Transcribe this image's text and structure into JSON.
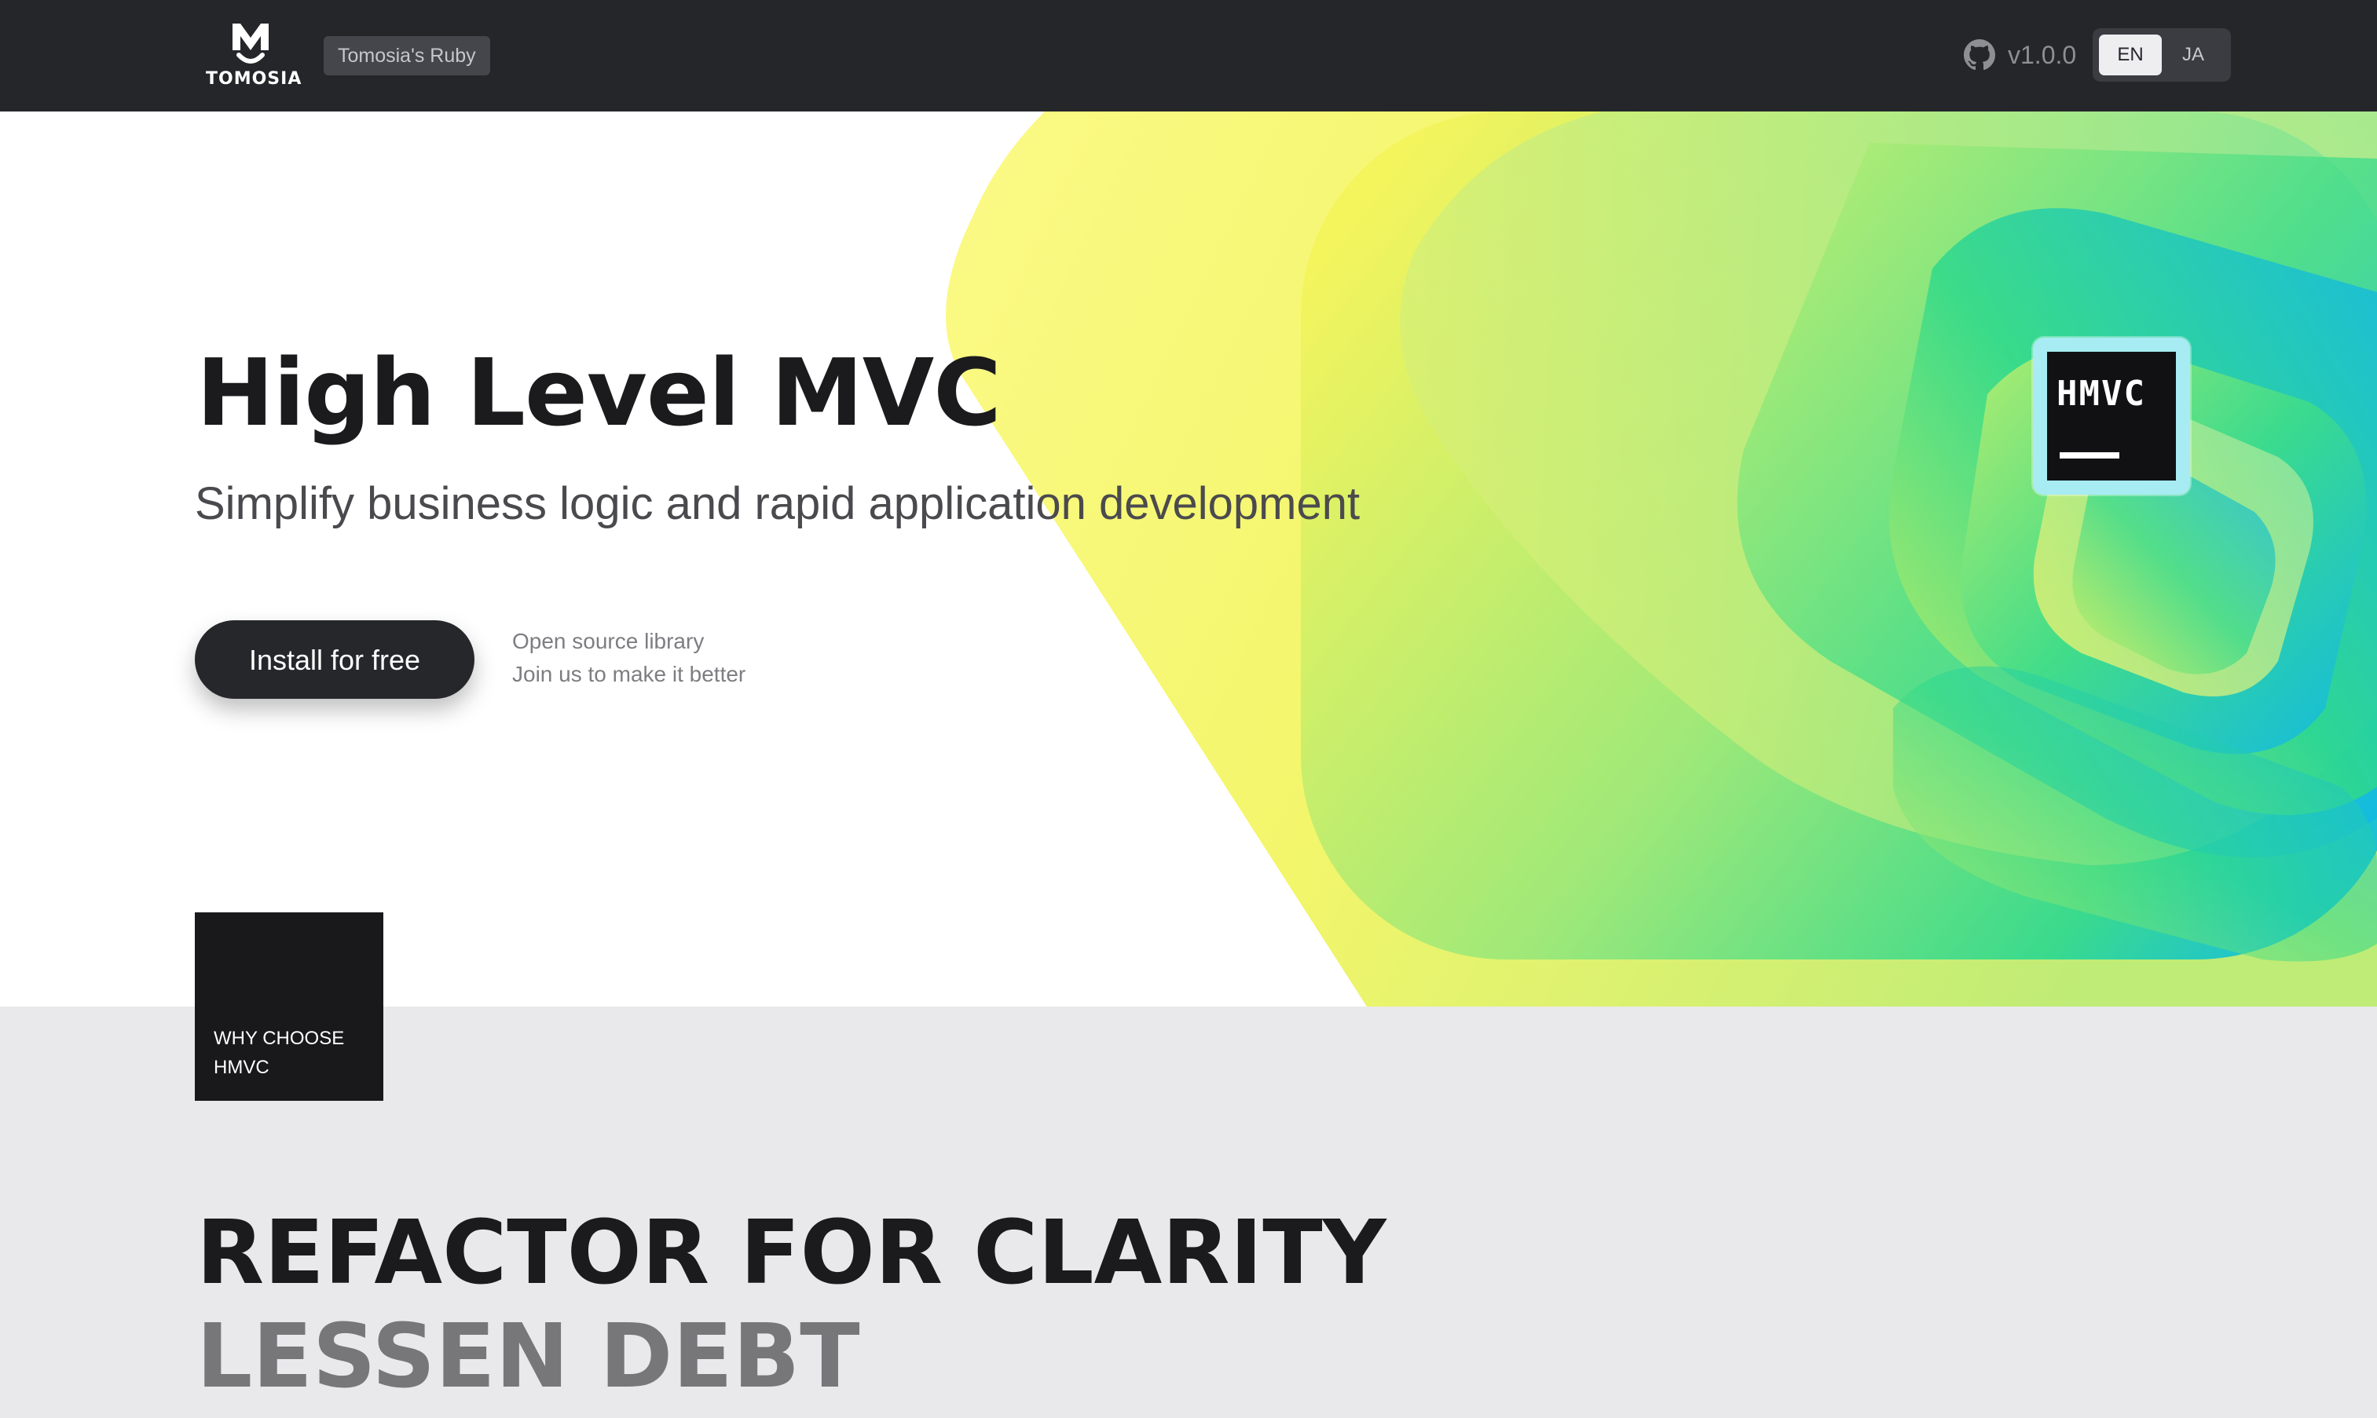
{
  "header": {
    "brand": "TOMOSIA",
    "repo_tag": "Tomosia's Ruby",
    "version": "v1.0.0",
    "languages": [
      "EN",
      "JA"
    ],
    "active_language": "EN"
  },
  "hero": {
    "title": "High Level MVC",
    "subtitle": "Simplify business logic and rapid application development",
    "cta_label": "Install for free",
    "note_line1": "Open source library",
    "note_line2": "Join us to make it better",
    "badge_text": "HMVC"
  },
  "why": {
    "line1": "WHY CHOOSE",
    "line2": "HMVC"
  },
  "section": {
    "headline": "REFACTOR FOR CLARITY",
    "subheadline": "LESSEN DEBT"
  },
  "colors": {
    "topbar": "#25262a",
    "lower_bg": "#e9e9eb",
    "accent_yellow": "#f7f56a",
    "accent_green": "#3ad98a",
    "accent_cyan": "#12b8e6"
  }
}
